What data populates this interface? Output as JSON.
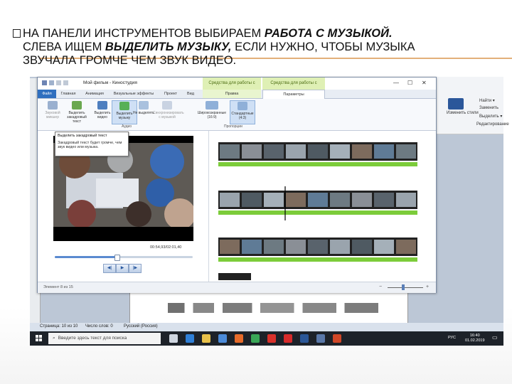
{
  "slide": {
    "heading_line1_pre": "НА ПАНЕЛИ ИНСТРУМЕНТОВ ВЫБИРАЕМ ",
    "heading_line1_em": "РАБОТА С МУЗЫКОЙ.",
    "heading_line2_pre": "СЛЕВА ИЩЕМ ",
    "heading_line2_em": "ВЫДЕЛИТЬ МУЗЫКУ,",
    "heading_line2_post": " ЕСЛИ НУЖНО, ЧТОБЫ МУЗЫКА",
    "heading_line3": "ЗВУЧАЛА ГРОМЧЕ ЧЕМ ЗВУК ВИДЕО.",
    "accent_color": "#e3b07a"
  },
  "word": {
    "style_buttons": [
      "Найти ▾",
      "Заменить",
      "Выделить ▾"
    ],
    "edit_label": "Редактирование",
    "change_styles": "Изменить стили",
    "status": {
      "page": "Страница: 10 из 10",
      "words": "Число слов: 0",
      "language": "Русский (Россия)"
    }
  },
  "moviemaker": {
    "title": "Мой фильм - Киностудия",
    "context_tabs": [
      "Средства для работы с видео",
      "Средства для работы с музыкой"
    ],
    "tabs": [
      "Файл",
      "Главная",
      "Анимация",
      "Визуальные эффекты",
      "Проект",
      "Вид",
      "Правка",
      "Параметры"
    ],
    "ribbon_buttons": [
      {
        "label": "Звуковой микшер",
        "icon": "sliders-icon",
        "color": "#9ab0cf",
        "state": "dim"
      },
      {
        "label": "Выделить закадровый текст",
        "icon": "microphone-icon",
        "color": "#6aa84f",
        "state": "normal"
      },
      {
        "label": "Выделить видео",
        "icon": "film-icon",
        "color": "#4e7fbf",
        "state": "normal"
      },
      {
        "label": "Выделить музыку",
        "icon": "music-note-icon",
        "color": "#57b056",
        "state": "selected"
      },
      {
        "label": "Не выделять",
        "icon": "stack-icon",
        "color": "#a9c1de",
        "state": "normal"
      },
      {
        "label": "Синхронизировать с музыкой",
        "icon": "sync-icon",
        "color": "#c9d3e2",
        "state": "dim"
      },
      {
        "label": "Широкоэкранные (16:9)",
        "icon": "widescreen-icon",
        "color": "#8fb0d8",
        "state": "normal"
      },
      {
        "label": "Стандартные (4:3)",
        "icon": "standard-screen-icon",
        "color": "#8fb0d8",
        "state": "selected"
      }
    ],
    "group_audio": "Аудио",
    "group_proportions": "Пропорции",
    "tooltip": {
      "title": "Выделить закадровый текст",
      "body": "Закадровый текст будет громче, чем звук видео или музыка."
    },
    "timecode": "00:54,93/02:01,40",
    "playback": {
      "prev": "◀|",
      "play": "▶",
      "next": "|▶"
    },
    "progress": 0.45,
    "status_text": "Элемент 8 из 15",
    "zoom_minus": "−",
    "zoom_plus": "+"
  },
  "taskbar": {
    "search_placeholder": "Введите здесь текст для поиска",
    "language": "РУС",
    "time": "16:40",
    "date": "01.02.2019",
    "apps": [
      {
        "name": "task-view-icon",
        "color": "#cfd6e0"
      },
      {
        "name": "edge-icon",
        "color": "#2f7fd6"
      },
      {
        "name": "file-explorer-icon",
        "color": "#e8c14a"
      },
      {
        "name": "store-icon",
        "color": "#4b8bd9"
      },
      {
        "name": "firefox-icon",
        "color": "#e66b2a"
      },
      {
        "name": "chrome-icon",
        "color": "#3aa757"
      },
      {
        "name": "yandex-icon",
        "color": "#d9312b"
      },
      {
        "name": "opera-icon",
        "color": "#d62b2b"
      },
      {
        "name": "word-icon",
        "color": "#2b5797"
      },
      {
        "name": "moviemaker-icon",
        "color": "#5a78a8"
      },
      {
        "name": "powerpoint-icon",
        "color": "#d04727"
      }
    ]
  }
}
